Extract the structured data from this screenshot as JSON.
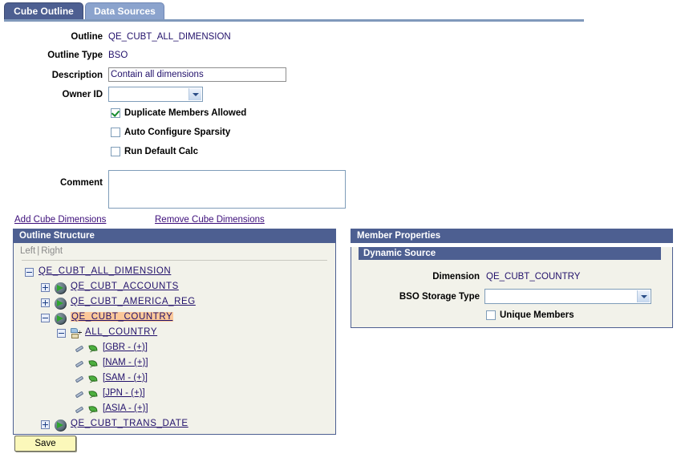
{
  "tabs": [
    {
      "label": "Cube Outline",
      "active": true
    },
    {
      "label": "Data Sources",
      "active": false
    }
  ],
  "form": {
    "outline_label": "Outline",
    "outline_value": "QE_CUBT_ALL_DIMENSION",
    "outline_type_label": "Outline Type",
    "outline_type_value": "BSO",
    "description_label": "Description",
    "description_value": "Contain all dimensions",
    "owner_id_label": "Owner ID",
    "owner_id_value": "",
    "comment_label": "Comment",
    "comment_value": "",
    "checkboxes": [
      {
        "label": "Duplicate Members Allowed",
        "checked": true
      },
      {
        "label": "Auto Configure Sparsity",
        "checked": false
      },
      {
        "label": "Run Default Calc",
        "checked": false
      }
    ]
  },
  "links": {
    "add_cube_dimensions": "Add Cube Dimensions",
    "remove_cube_dimensions": "Remove Cube Dimensions"
  },
  "outline_structure": {
    "title": "Outline Structure",
    "left_label": "Left",
    "separator": "|",
    "right_label": "Right",
    "tree": [
      {
        "label": "QE_CUBT_ALL_DIMENSION",
        "toggle": "minus",
        "icon": "none",
        "indent": 0,
        "selected": false
      },
      {
        "label": "QE_CUBT_ACCOUNTS",
        "toggle": "plus",
        "icon": "globe",
        "indent": 1,
        "selected": false
      },
      {
        "label": "QE_CUBT_AMERICA_REG",
        "toggle": "plus",
        "icon": "globe",
        "indent": 1,
        "selected": false
      },
      {
        "label": "QE_CUBT_COUNTRY",
        "toggle": "minus",
        "icon": "globe",
        "indent": 1,
        "selected": true
      },
      {
        "label": "ALL_COUNTRY",
        "toggle": "minus",
        "icon": "member",
        "indent": 2,
        "selected": false
      },
      {
        "label": "[GBR - (+)]",
        "toggle": "none",
        "icon": "leaf",
        "indent": 3,
        "selected": false
      },
      {
        "label": "[NAM - (+)]",
        "toggle": "none",
        "icon": "leaf",
        "indent": 3,
        "selected": false
      },
      {
        "label": "[SAM - (+)]",
        "toggle": "none",
        "icon": "leaf",
        "indent": 3,
        "selected": false
      },
      {
        "label": "[JPN - (+)]",
        "toggle": "none",
        "icon": "leaf",
        "indent": 3,
        "selected": false
      },
      {
        "label": "[ASIA - (+)]",
        "toggle": "none",
        "icon": "leaf",
        "indent": 3,
        "selected": false
      },
      {
        "label": "QE_CUBT_TRANS_DATE",
        "toggle": "plus",
        "icon": "globe",
        "indent": 1,
        "selected": false
      }
    ]
  },
  "member_properties": {
    "title": "Member Properties",
    "subtitle": "Dynamic Source",
    "dimension_label": "Dimension",
    "dimension_value": "QE_CUBT_COUNTRY",
    "bso_storage_type_label": "BSO Storage Type",
    "bso_storage_type_value": "",
    "unique_members_label": "Unique Members",
    "unique_members_checked": false
  },
  "actions": {
    "save_label": "Save"
  },
  "colors": {
    "header_blue": "#4d5f91",
    "tab_inactive": "#8ba3cd",
    "panel_bg": "#f2f2ea",
    "link": "#3c0d7a",
    "value_text": "#22116b",
    "selection": "#fbc89a",
    "save_button": "#fbf8ba"
  }
}
